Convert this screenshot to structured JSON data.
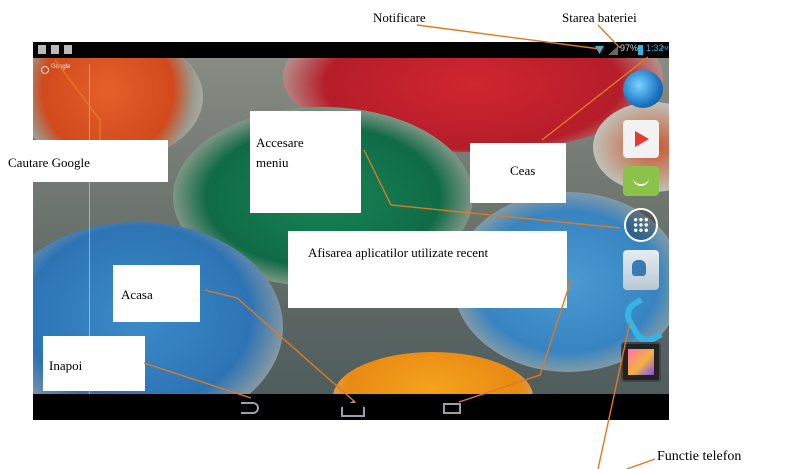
{
  "annotations": {
    "notification": "Notificare",
    "battery_status": "Starea bateriei",
    "google_search": "Cautare Google",
    "menu_access": "Accesare meniu",
    "clock": "Ceas",
    "recent_apps": "Afisarea aplicatilor utilizate recent",
    "home": "Acasa",
    "back": "Inapoi",
    "phone_function": "Functie telefon"
  },
  "status_bar": {
    "battery_percent": "97%",
    "time": "1:32",
    "time_suffix": "PM"
  },
  "search": {
    "label": "Google"
  },
  "colors": {
    "annotation_line": "#e07a1f",
    "status_time": "#33b5e5",
    "navbar": "#000000"
  }
}
